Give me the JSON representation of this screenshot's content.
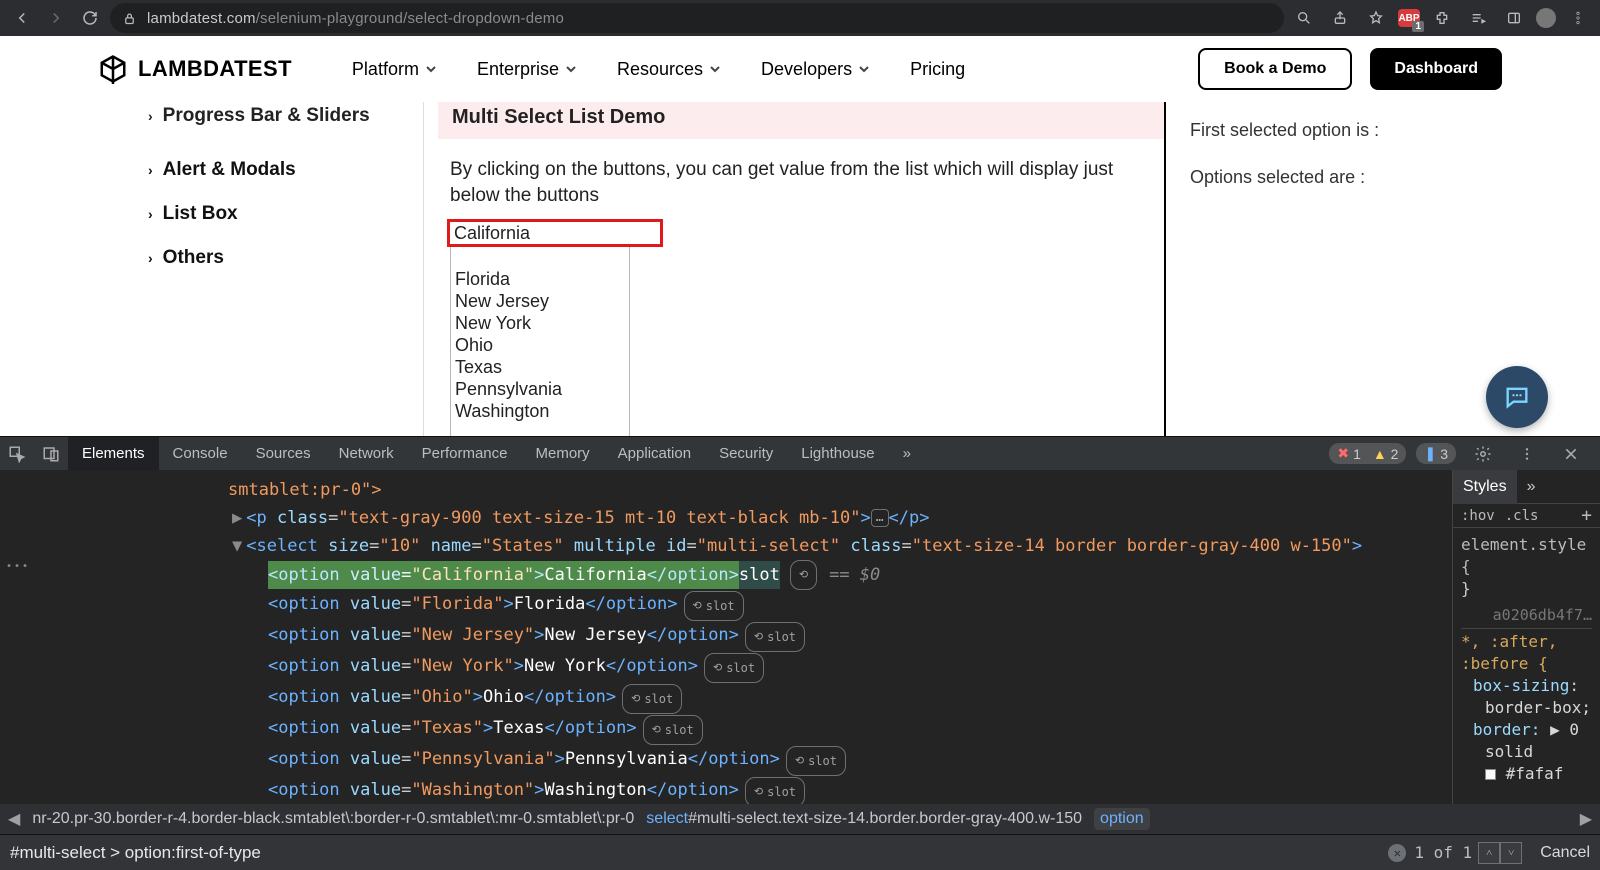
{
  "browser": {
    "url_host": "lambdatest.com",
    "url_path": "/selenium-playground/select-dropdown-demo"
  },
  "header": {
    "brand": "LAMBDATEST",
    "nav": [
      "Platform",
      "Enterprise",
      "Resources",
      "Developers",
      "Pricing"
    ],
    "cta_demo": "Book a Demo",
    "cta_dash": "Dashboard"
  },
  "sidebar": {
    "items": [
      "Progress Bar & Sliders",
      "Alert & Modals",
      "List Box",
      "Others"
    ]
  },
  "demo": {
    "title": "Multi Select List Demo",
    "desc": "By clicking on the buttons, you can get value from the list which will display just below the buttons",
    "options": [
      "California",
      "Florida",
      "New Jersey",
      "New York",
      "Ohio",
      "Texas",
      "Pennsylvania",
      "Washington"
    ],
    "right1": "First selected option is :",
    "right2": "Options selected are :"
  },
  "devtools": {
    "tabs": [
      "Elements",
      "Console",
      "Sources",
      "Network",
      "Performance",
      "Memory",
      "Application",
      "Security",
      "Lighthouse"
    ],
    "errors": "1",
    "warnings": "2",
    "info": "3",
    "line0": "smtablet:pr-0\">",
    "p_class": "text-gray-900 text-size-15 mt-10 text-black mb-10",
    "select_open": "<select size=\"10\" name=\"States\" multiple id=\"multi-select\" class=\"text-size-14 border border-gray-400 w-150\">",
    "hl_option": "<option value=\"California\">California</option>",
    "hl_after": "slot",
    "eq0": "== $0",
    "breadcrumb_left": "nr-20.pr-30.border-r-4.border-black.smtablet\\:border-r-0.smtablet\\:mr-0.smtablet\\:pr-0",
    "breadcrumb_mid": "select#multi-select.text-size-14.border.border-gray-400.w-150",
    "breadcrumb_active": "option",
    "find_value": "#multi-select > option:first-of-type",
    "find_count": "1 of 1",
    "cancel": "Cancel",
    "styles": {
      "tabs_visible": "Styles",
      "hov": ":hov",
      "cls": ".cls",
      "elstyle": "element.style {",
      "brace": "}",
      "file": "a0206db4f7…",
      "sel": "*, :after, :before {",
      "prop1": "box-sizing",
      "val1": "border-box;",
      "prop2": "border:",
      "val2_a": "▶ 0",
      "val2_b": "solid",
      "val2_c": "#fafaf"
    }
  },
  "options_raw": [
    {
      "v": "Florida",
      "t": "Florida"
    },
    {
      "v": "New Jersey",
      "t": "New Jersey"
    },
    {
      "v": "New York",
      "t": "New York"
    },
    {
      "v": "Ohio",
      "t": "Ohio"
    },
    {
      "v": "Texas",
      "t": "Texas"
    },
    {
      "v": "Pennsylvania",
      "t": "Pennsylvania"
    },
    {
      "v": "Washington",
      "t": "Washington"
    }
  ],
  "slot_label": "slot"
}
